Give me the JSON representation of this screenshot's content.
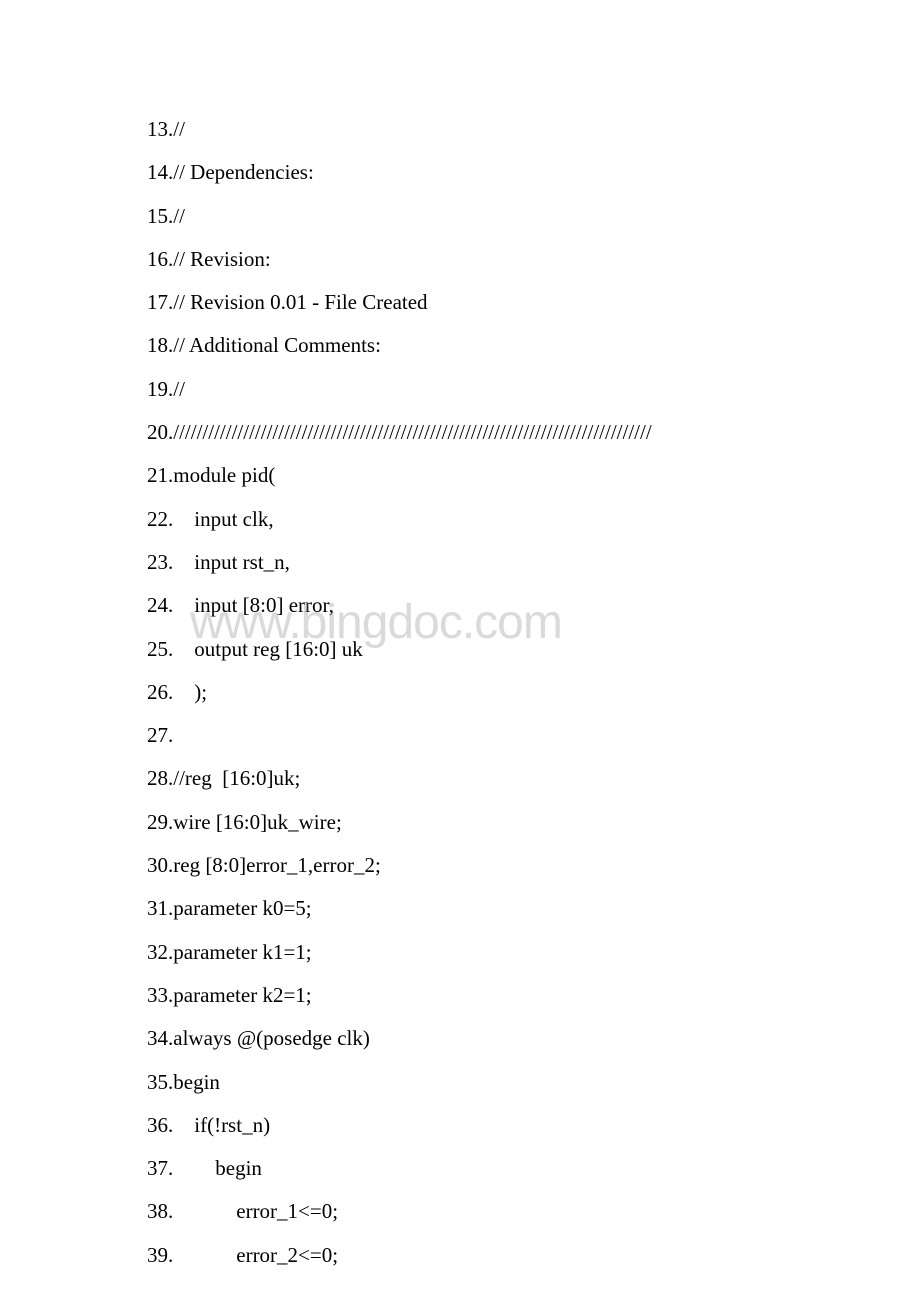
{
  "watermark": "www.bingdoc.com",
  "lines": [
    "13.//",
    "14.// Dependencies:",
    "15.//",
    "16.// Revision:",
    "17.// Revision 0.01 - File Created",
    "18.// Additional Comments:",
    "19.//",
    "20.//////////////////////////////////////////////////////////////////////////////////",
    "21.module pid(",
    "22.    input clk,",
    "23.    input rst_n,",
    "24.    input [8:0] error,",
    "25.    output reg [16:0] uk",
    "26.    );",
    "27.",
    "28.//reg  [16:0]uk;",
    "29.wire [16:0]uk_wire;",
    "30.reg [8:0]error_1,error_2;",
    "31.parameter k0=5;",
    "32.parameter k1=1;",
    "33.parameter k2=1;",
    "34.always @(posedge clk)",
    "35.begin",
    "36.    if(!rst_n)",
    "37.        begin",
    "38.            error_1<=0;",
    "39.            error_2<=0;"
  ]
}
